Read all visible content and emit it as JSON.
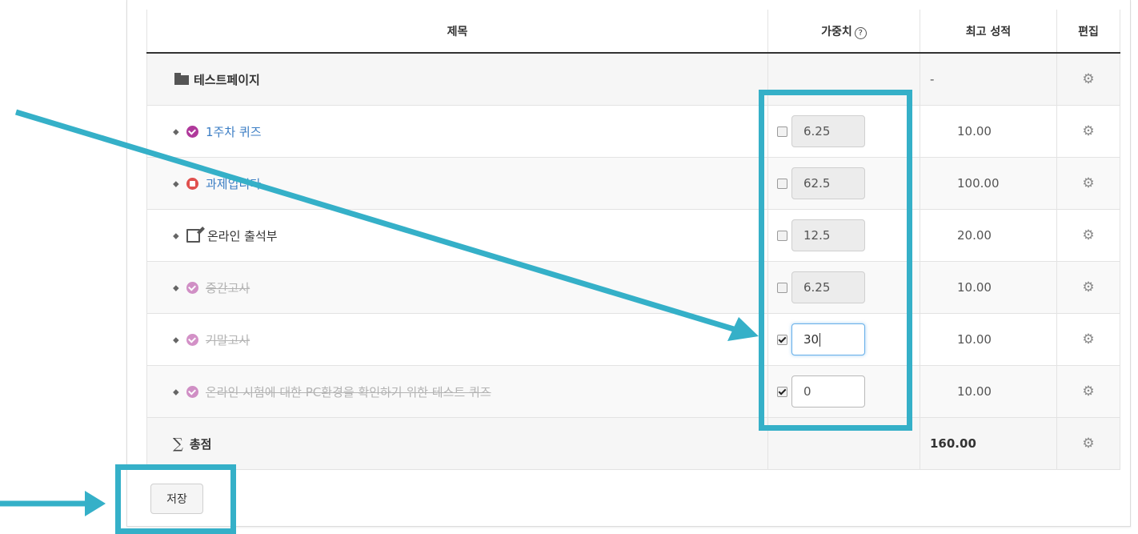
{
  "header": {
    "title_col": "제목",
    "weight_col": "가중치",
    "weight_help_icon": "question-circle-icon",
    "max_grade_col": "최고 성적",
    "edit_col": "편집"
  },
  "category": {
    "name": "테스트페이지",
    "icon": "folder-icon",
    "max_grade": "-"
  },
  "items": [
    {
      "name": "1주차 퀴즈",
      "type": "quiz",
      "icon_color": "#b0399b",
      "style": "link",
      "weight": "6.25",
      "override": false,
      "max_grade": "10.00"
    },
    {
      "name": "과제입니다.",
      "type": "assign",
      "icon_color": "#e0504e",
      "style": "link",
      "weight": "62.5",
      "override": false,
      "max_grade": "100.00"
    },
    {
      "name": "온라인 출석부",
      "type": "edit",
      "icon_color": "#555555",
      "style": "normal",
      "weight": "12.5",
      "override": false,
      "max_grade": "20.00"
    },
    {
      "name": "중간고사",
      "type": "quiz",
      "icon_color": "#b0399b",
      "style": "dimmed",
      "weight": "6.25",
      "override": false,
      "max_grade": "10.00"
    },
    {
      "name": "기말고사",
      "type": "quiz",
      "icon_color": "#b0399b",
      "style": "dimmed",
      "weight": "30",
      "override": true,
      "max_grade": "10.00"
    },
    {
      "name": "온라인 시험에 대한 PC환경을 확인하기 위한 테스트 퀴즈",
      "type": "quiz",
      "icon_color": "#b0399b",
      "style": "dimmed",
      "weight": "0",
      "override": true,
      "max_grade": "10.00"
    }
  ],
  "total": {
    "label": "총점",
    "icon": "sigma-icon",
    "max_grade": "160.00"
  },
  "save_button": "저장",
  "colors": {
    "annotation": "#35b0c8",
    "link": "#3b7dc4"
  }
}
